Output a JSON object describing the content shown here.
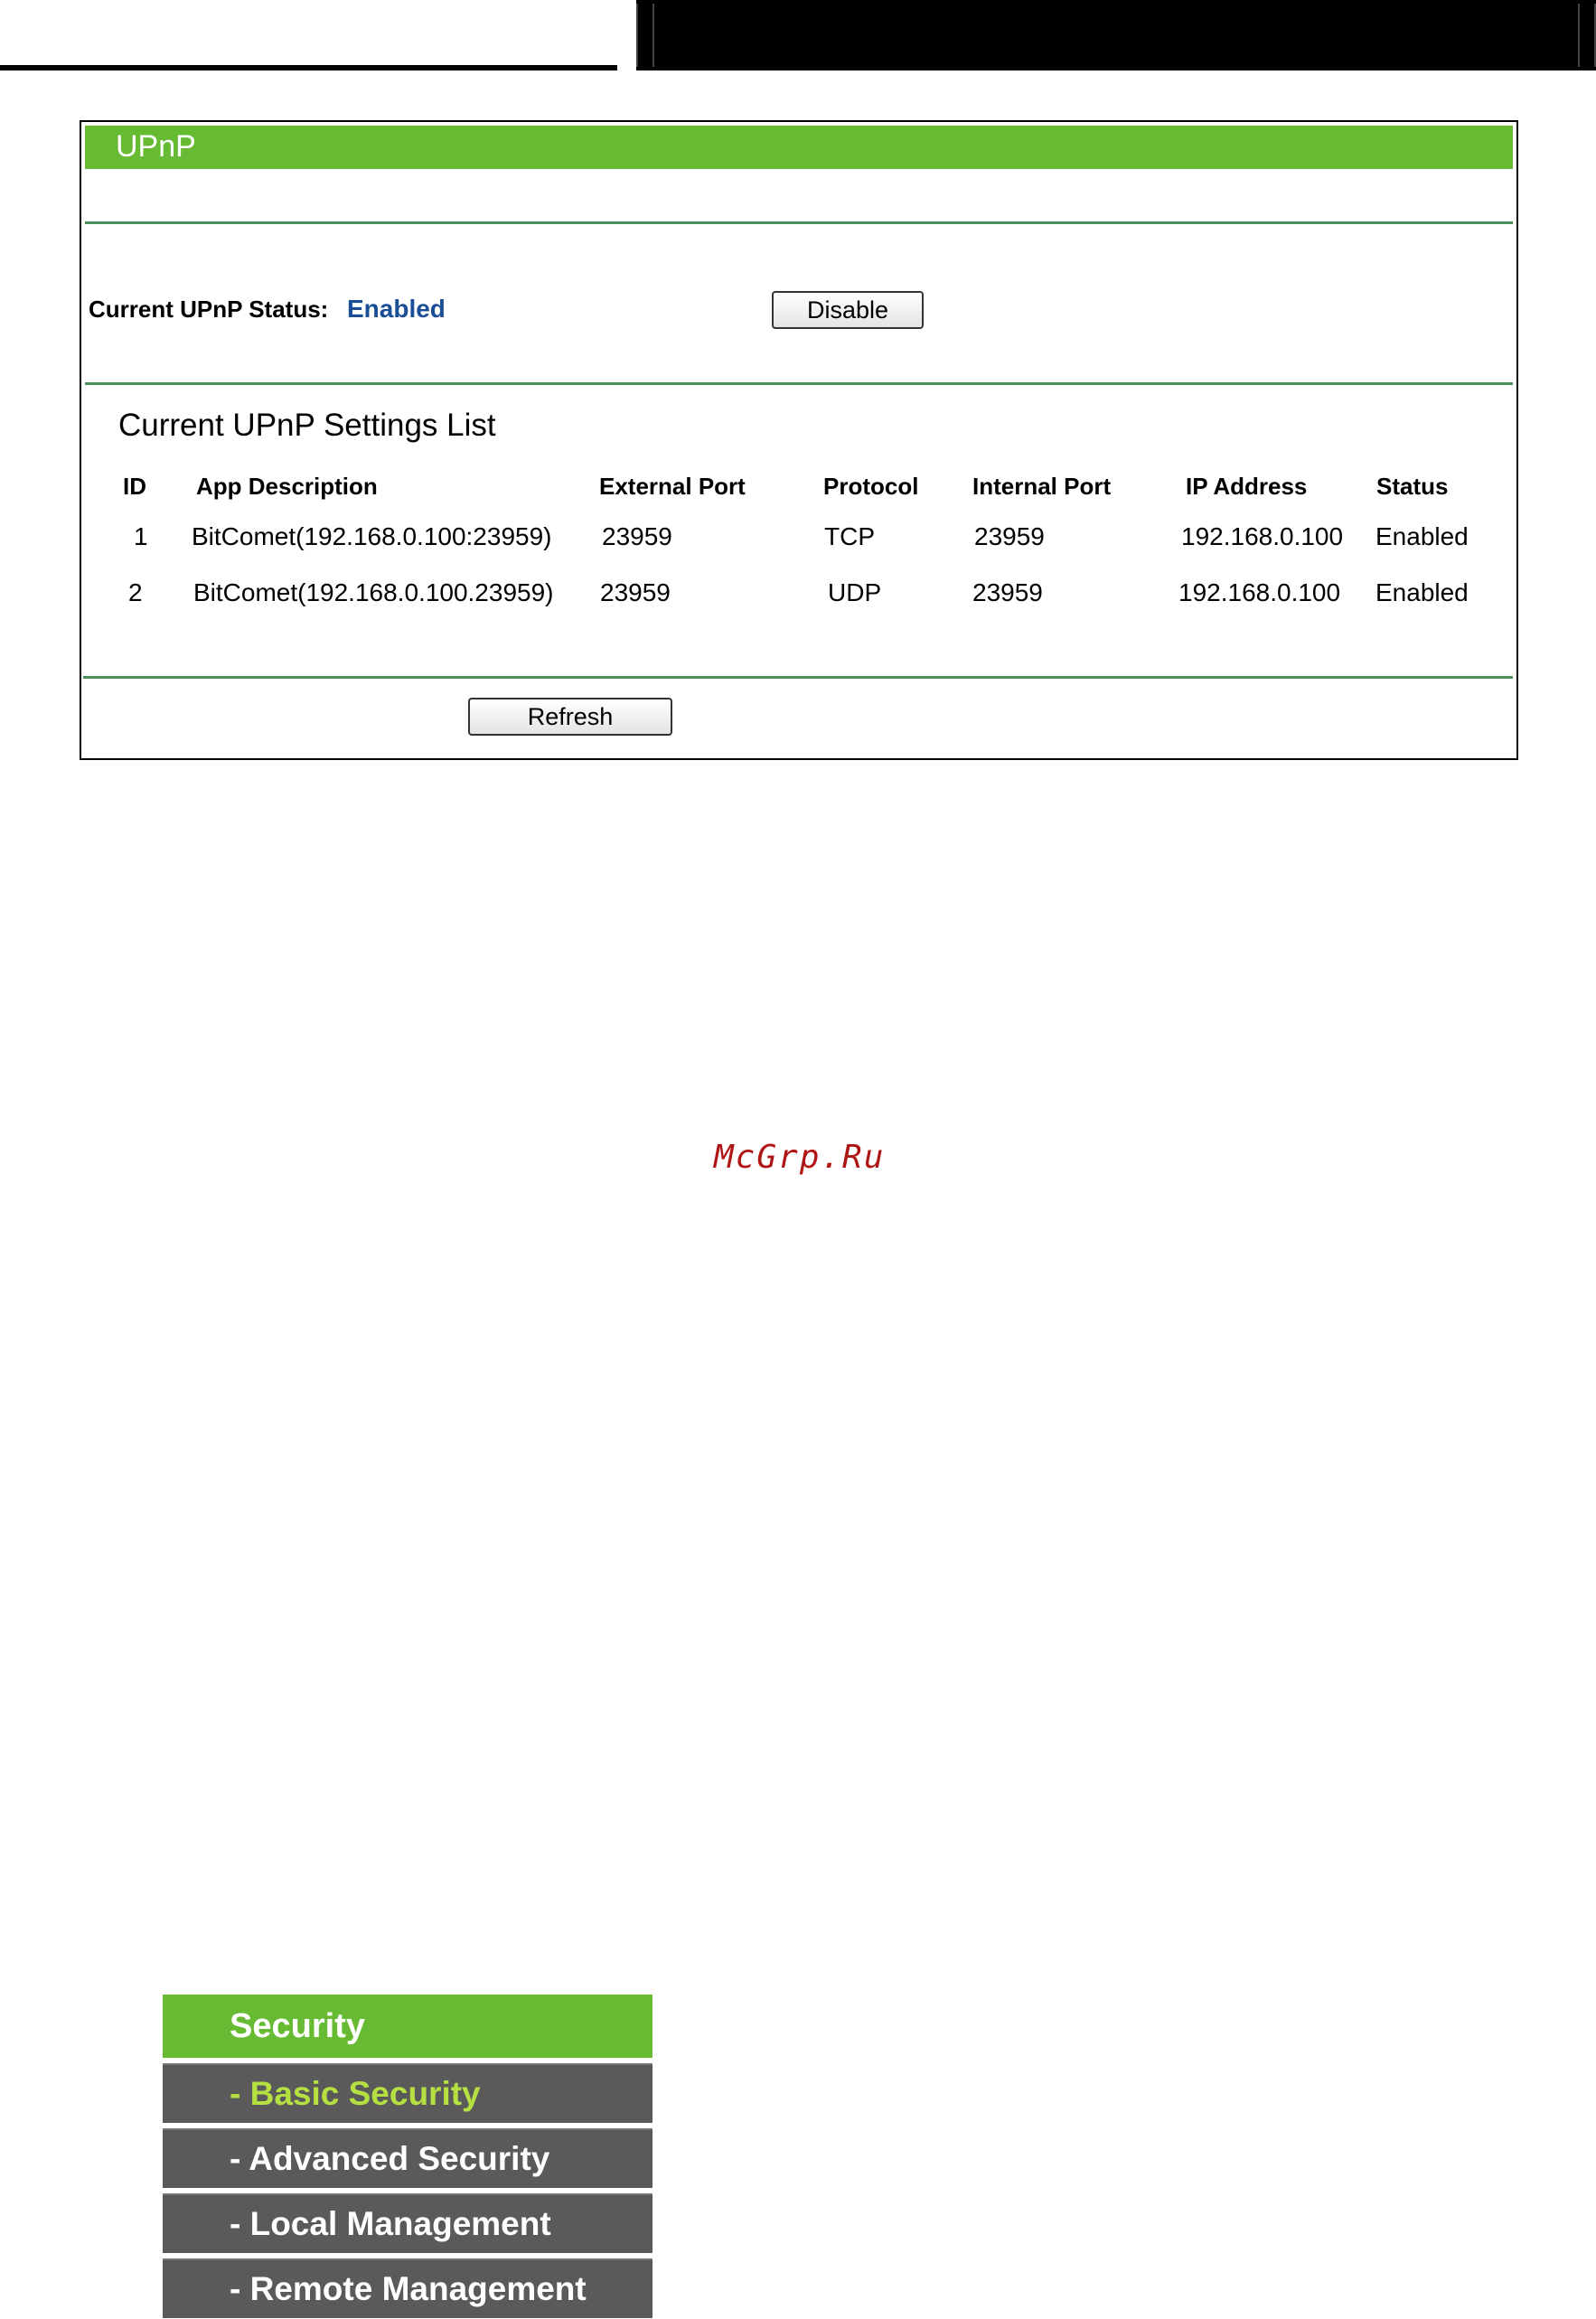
{
  "upnp": {
    "title": "UPnP",
    "status_label": "Current UPnP Status:",
    "status_value": "Enabled",
    "disable_label": "Disable",
    "list_title": "Current UPnP Settings List",
    "columns": [
      "ID",
      "App Description",
      "External Port",
      "Protocol",
      "Internal Port",
      "IP Address",
      "Status"
    ],
    "rows": [
      {
        "id": "1",
        "app": "BitComet(192.168.0.100:23959)",
        "ext_port": "23959",
        "protocol": "TCP",
        "int_port": "23959",
        "ip": "192.168.0.100",
        "status": "Enabled"
      },
      {
        "id": "2",
        "app": "BitComet(192.168.0.100.23959)",
        "ext_port": "23959",
        "protocol": "UDP",
        "int_port": "23959",
        "ip": "192.168.0.100",
        "status": "Enabled"
      }
    ],
    "refresh_label": "Refresh"
  },
  "watermark": "McGrp.Ru",
  "security_menu": {
    "header": "Security",
    "items": [
      {
        "label": "- Basic Security",
        "active": true
      },
      {
        "label": "- Advanced Security",
        "active": false
      },
      {
        "label": "- Local Management",
        "active": false
      },
      {
        "label": "- Remote Management",
        "active": false
      }
    ]
  },
  "colors": {
    "header_green": "#66bb33",
    "divider_green": "#4a8f5a",
    "status_blue": "#1a4e96",
    "menu_gray": "#5a5a5a",
    "menu_active": "#b5e041",
    "watermark_red": "#b01515"
  }
}
